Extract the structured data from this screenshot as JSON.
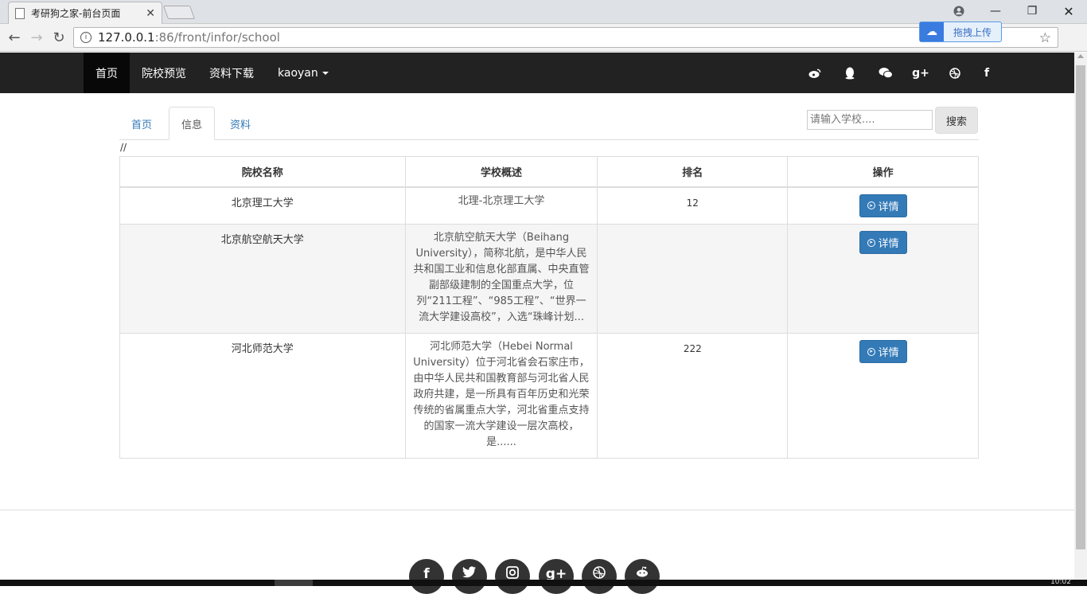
{
  "browser": {
    "tab_title": "考研狗之家-前台页面",
    "url_host": "127.0.0.1",
    "url_path": ":86/front/infor/school",
    "extension_label": "拖拽上传",
    "taskbar_clock": "10:02"
  },
  "sitenav": {
    "items": [
      {
        "label": "首页",
        "active": true
      },
      {
        "label": "院校预览"
      },
      {
        "label": "资料下载"
      },
      {
        "label": "kaoyan"
      }
    ],
    "social_icons": [
      "weibo-icon",
      "qq-icon",
      "wechat-icon",
      "google-plus-icon",
      "dribbble-icon",
      "facebook-icon"
    ]
  },
  "content_tabs": [
    {
      "label": "首页"
    },
    {
      "label": "信息",
      "active": true
    },
    {
      "label": "资料"
    }
  ],
  "search": {
    "placeholder": "请输入学校....",
    "button_label": "搜索"
  },
  "slashes": "//",
  "table": {
    "headers": [
      "院校名称",
      "学校概述",
      "排名",
      "操作"
    ],
    "rows": [
      {
        "name": "北京理工大学",
        "desc": "北理-北京理工大学",
        "rank": "12",
        "action": "详情"
      },
      {
        "name": "北京航空航天大学",
        "desc": "北京航空航天大学（Beihang University），简称北航，是中华人民共和国工业和信息化部直属、中央直管副部级建制的全国重点大学，位列“211工程”、“985工程”、“世界一流大学建设高校”，入选“珠峰计划...",
        "rank": "",
        "action": "详情"
      },
      {
        "name": "河北师范大学",
        "desc": "河北师范大学（Hebei Normal University）位于河北省会石家庄市，由中华人民共和国教育部与河北省人民政府共建，是一所具有百年历史和光荣传统的省属重点大学，河北省重点支持的国家一流大学建设一层次高校，是......",
        "rank": "222",
        "action": "详情"
      }
    ]
  },
  "footer_icons": [
    "facebook-icon",
    "twitter-icon",
    "instagram-icon",
    "google-plus-icon",
    "dribbble-icon",
    "reddit-icon"
  ]
}
